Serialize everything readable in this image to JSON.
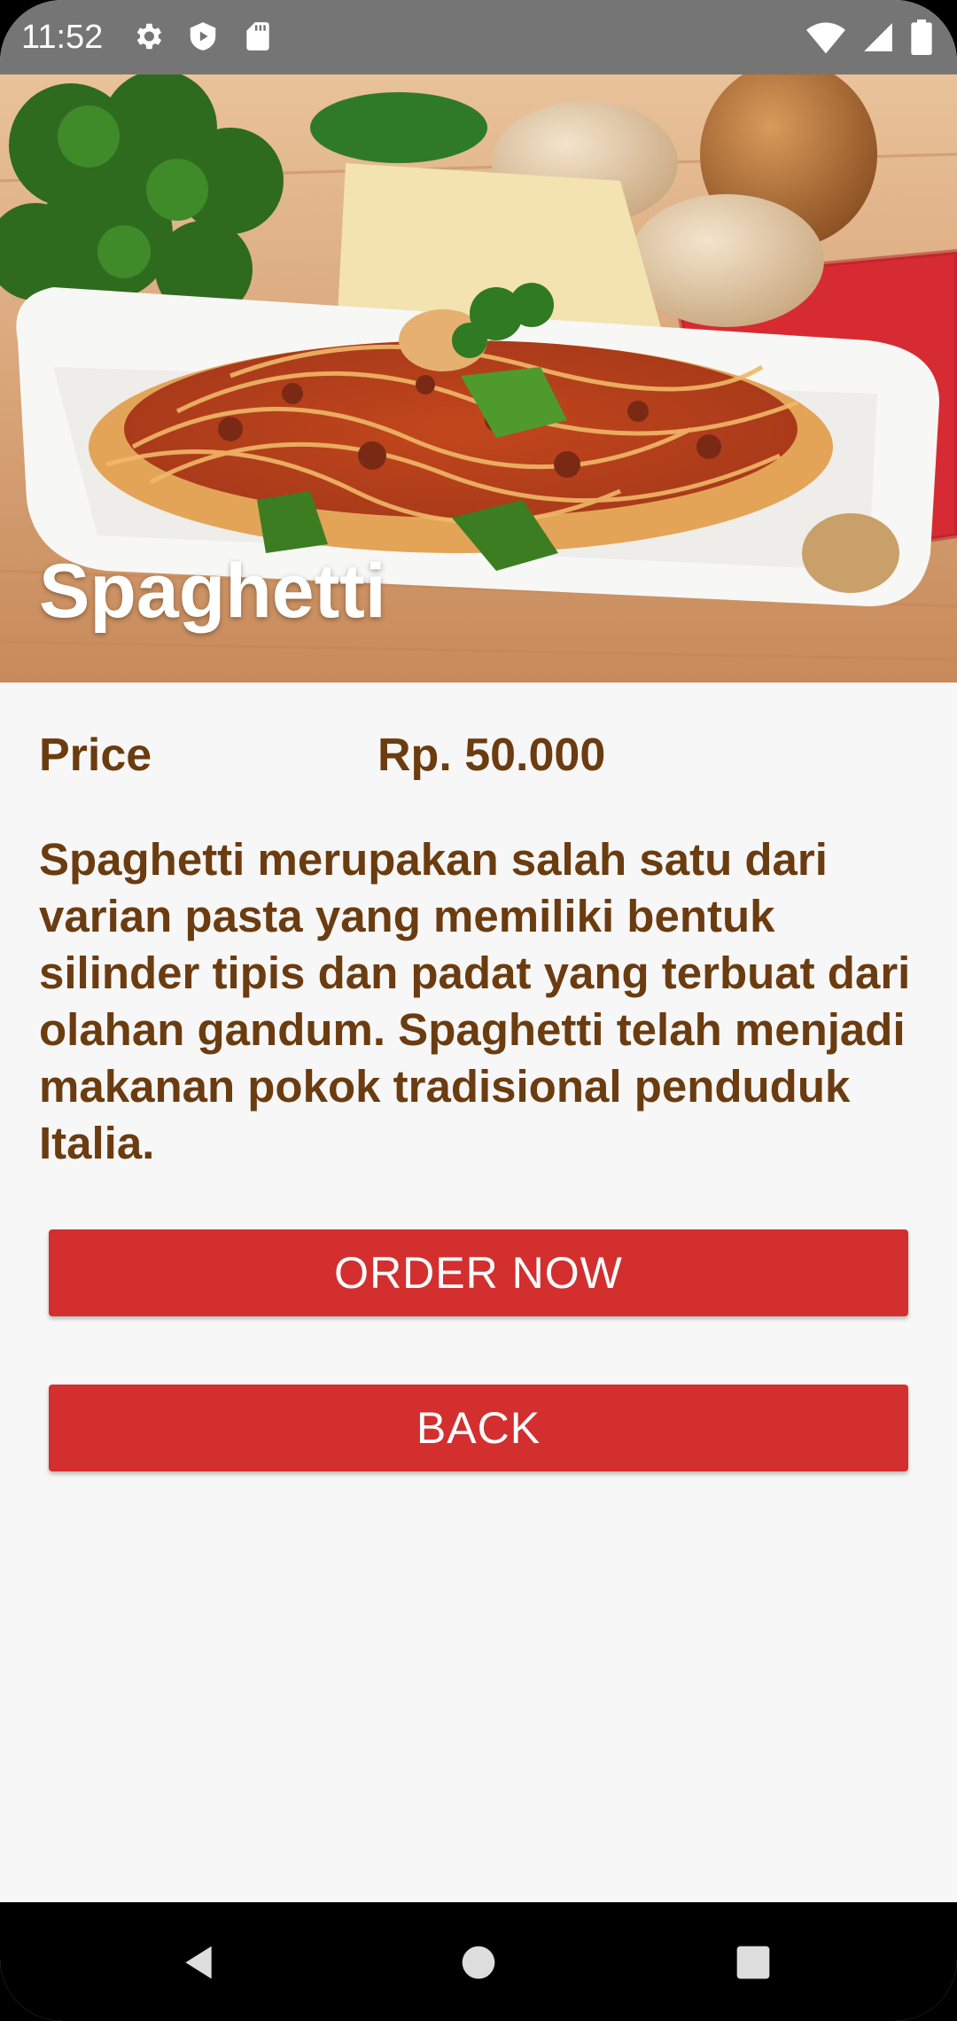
{
  "status_bar": {
    "time": "11:52",
    "icons_left": [
      "gear-icon",
      "play-store-icon",
      "sd-card-icon"
    ],
    "icons_right": [
      "wifi-icon",
      "signal-icon",
      "battery-icon"
    ]
  },
  "hero": {
    "title": "Spaghetti",
    "image": "spaghetti-dish-photo"
  },
  "price": {
    "label": "Price",
    "value": "Rp. 50.000"
  },
  "description": "Spaghetti merupakan salah satu dari varian pasta yang memiliki bentuk silinder tipis dan padat yang terbuat dari olahan gandum. Spaghetti telah menjadi makanan pokok tradisional penduduk Italia.",
  "buttons": {
    "order_label": "ORDER NOW",
    "back_label": "BACK"
  },
  "nav_bar": {
    "icons": [
      "back-icon",
      "home-icon",
      "recents-icon"
    ]
  },
  "colors": {
    "accent": "#d32f2f",
    "text_brown": "#6b3c10",
    "status_bar": "#757575",
    "background": "#f8f7f7"
  }
}
